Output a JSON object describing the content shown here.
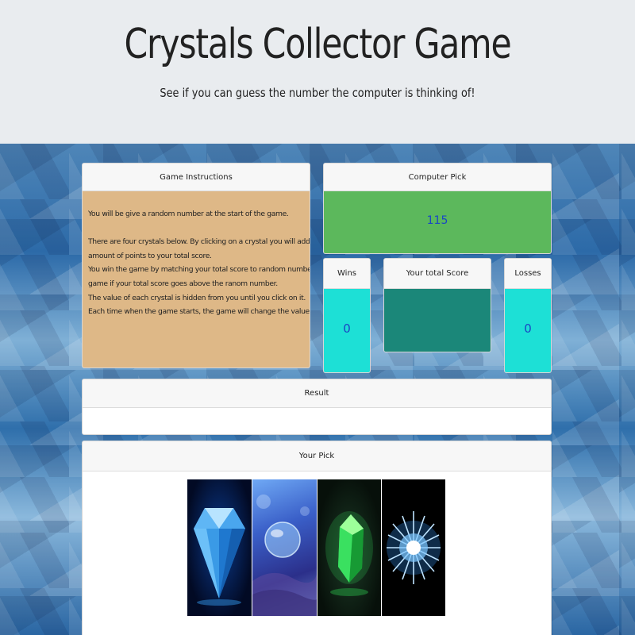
{
  "header": {
    "title": "Crystals Collector Game",
    "subtitle": "See if you can guess the number the computer is thinking of!"
  },
  "instructions": {
    "heading": "Game Instructions",
    "lines": [
      "You will be give a random number at the start of the game.",
      "",
      "There are four crystals below. By clicking on a crystal you will add a specific",
      "amount of points to your total score.",
      "You win the game by matching your total score to random number, you lose the",
      "game if your total score goes above the ranom number.",
      "The value of each crystal is hidden from you until you click on it.",
      "Each time when the game starts, the game will change the values of each crystal."
    ]
  },
  "computer_pick": {
    "heading": "Computer Pick",
    "value": "115"
  },
  "wins": {
    "heading": "Wins",
    "value": "0"
  },
  "total_score": {
    "heading": "Your total Score",
    "value": ""
  },
  "losses": {
    "heading": "Losses",
    "value": "0"
  },
  "result": {
    "heading": "Result",
    "value": ""
  },
  "your_pick": {
    "heading": "Your Pick",
    "crystals": [
      "blue-diamond",
      "blue-orb",
      "green-gem",
      "blue-starburst"
    ]
  },
  "colors": {
    "instructions_bg": "#deb887",
    "computer_pick_bg": "#5cb85c",
    "wins_losses_bg": "#1de0d6",
    "total_score_bg": "#1b8779",
    "number_text": "#1a47c4"
  }
}
